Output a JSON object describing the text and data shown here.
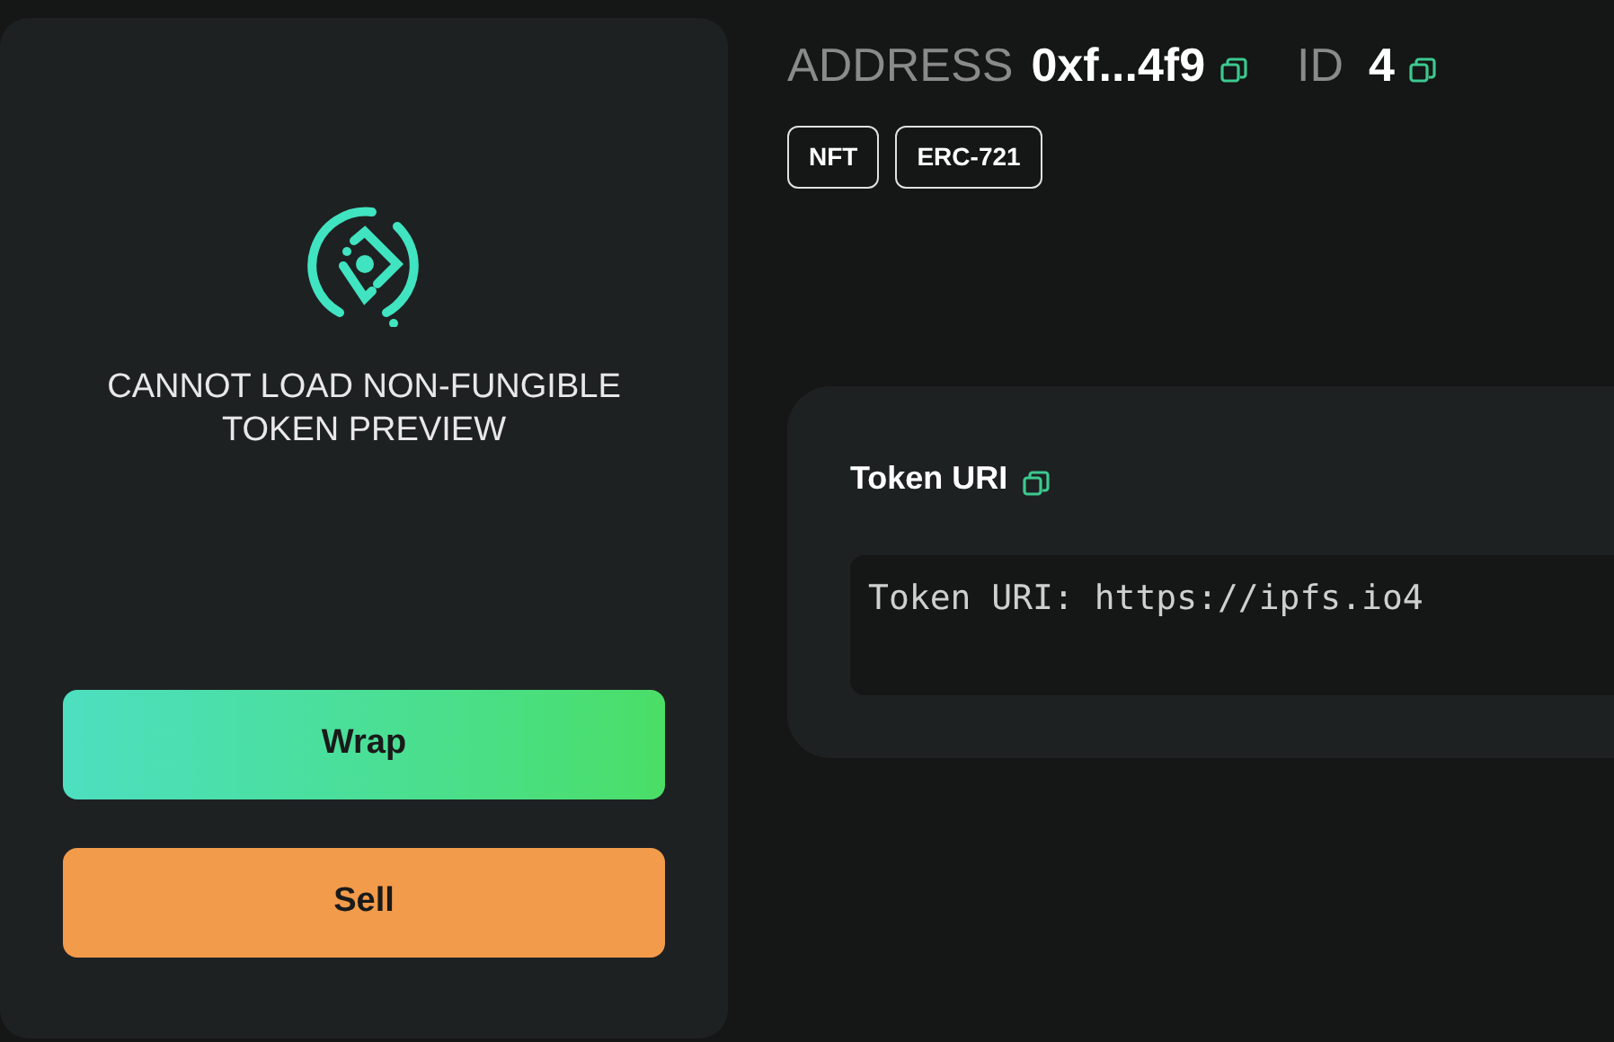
{
  "preview": {
    "message": "CANNOT LOAD NON-FUNGIBLE TOKEN PREVIEW"
  },
  "actions": [
    {
      "label": "Wrap",
      "kind": "gradient"
    },
    {
      "label": "Sell",
      "kind": "orange"
    }
  ],
  "header": {
    "address_label": "ADDRESS",
    "address": "0xf...4f9",
    "id_label": "ID",
    "id": "4"
  },
  "tags": [
    "NFT",
    "ERC-721"
  ],
  "token_uri": {
    "title": "Token URI",
    "value": "Token URI: https://ipfs.io4"
  }
}
